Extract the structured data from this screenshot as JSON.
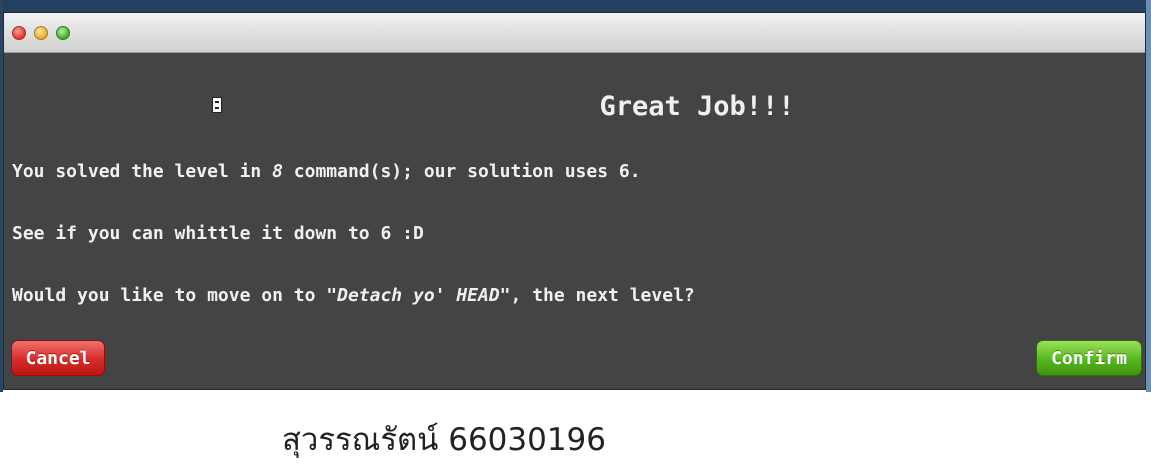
{
  "dialog": {
    "title": "Great Job!!!",
    "line1": {
      "before": "You solved the level in ",
      "count": "8",
      "after": " command(s); our solution uses 6."
    },
    "line2": "See if you can whittle it down to 6 :D",
    "line3": {
      "before": "Would you like to move on to ",
      "level_name": "\"Detach yo' HEAD\"",
      "after": ", the next level?"
    },
    "cancel_label": "Cancel",
    "confirm_label": "Confirm"
  },
  "caption": "สุวรรณรัตน์ 66030196",
  "colors": {
    "dialog_bg": "#444444",
    "cancel": "#d82b28",
    "confirm": "#55b81e"
  },
  "icons": [
    "close-window-icon",
    "minimize-window-icon",
    "maximize-window-icon",
    "mouse-cursor-icon"
  ]
}
